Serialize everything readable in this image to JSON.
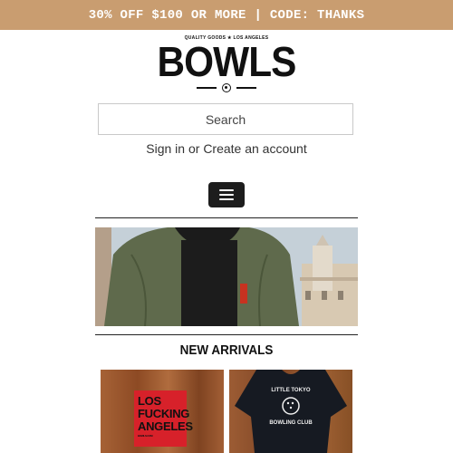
{
  "promo_banner": {
    "text": "30% OFF $100 OR MORE | CODE: THANKS"
  },
  "logo": {
    "tagline": "QUALITY GOODS ★ LOS ANGELES",
    "wordmark": "BOWLS"
  },
  "search": {
    "placeholder": "Search"
  },
  "account": {
    "sign_in": "Sign in",
    "or": " or ",
    "create": "Create an account"
  },
  "nav": {
    "menu_icon": "hamburger-icon"
  },
  "hero": {
    "image": "man-in-olive-bomber-jacket"
  },
  "sections": {
    "new_arrivals_title": "NEW ARRIVALS"
  },
  "products": [
    {
      "image": "los-fucking-angeles-sticker",
      "sticker_lines": [
        "LOS",
        "FUCKING",
        "ANGELES"
      ],
      "sticker_small": "BOWLS.COM"
    },
    {
      "image": "little-tokyo-bowling-club-tshirt",
      "shirt_lines": [
        "LITTLE TOKYO",
        "BOWLING CLUB"
      ]
    }
  ],
  "colors": {
    "promo_bg": "#c99d70",
    "menu_bg": "#1d1d1d",
    "sticker_red": "#d7212a"
  }
}
